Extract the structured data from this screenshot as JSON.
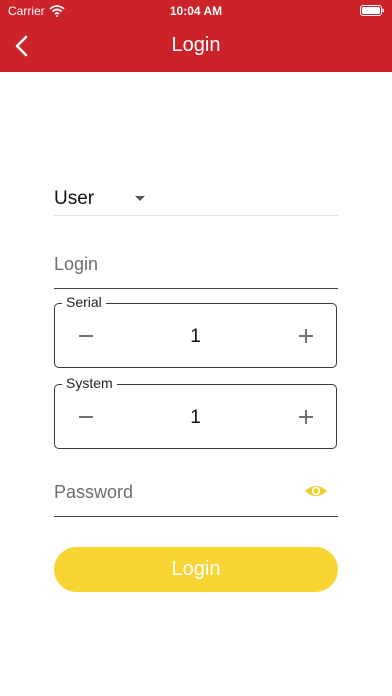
{
  "status_bar": {
    "carrier": "Carrier",
    "time": "10:04 AM"
  },
  "nav": {
    "title": "Login"
  },
  "form": {
    "user_select": {
      "value": "User"
    },
    "login_field": {
      "placeholder": "Login"
    },
    "serial": {
      "label": "Serial",
      "value": "1"
    },
    "system": {
      "label": "System",
      "value": "1"
    },
    "password_field": {
      "placeholder": "Password"
    },
    "submit_label": "Login"
  },
  "colors": {
    "header": "#cc2229",
    "accent": "#f8d532"
  },
  "icons": {
    "back": "chevron-left-icon",
    "wifi": "wifi-icon",
    "battery": "battery-icon",
    "visibility": "eye-icon",
    "dropdown": "caret-down-icon"
  }
}
